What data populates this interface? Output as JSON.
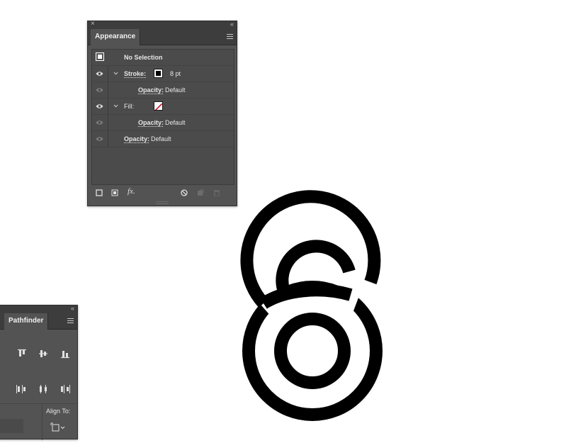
{
  "appearance": {
    "tab": "Appearance",
    "header": "No Selection",
    "rows": [
      {
        "label": "Stroke:",
        "value": "8 pt"
      },
      {
        "label": "Opacity:",
        "value": "Default"
      },
      {
        "label": "Fill:"
      },
      {
        "label": "Opacity:",
        "value": "Default"
      },
      {
        "label": "Opacity:",
        "value": "Default"
      }
    ],
    "fx": "fx."
  },
  "pathfinder": {
    "tab": "Pathfinder",
    "align_to_label": "Align To:"
  },
  "colors": {
    "panel": "#535353",
    "artwork": "#000000",
    "fill_none_slash": "#c8102e"
  },
  "icons": [
    "close-icon",
    "collapse-icon",
    "menu-icon",
    "eye-icon",
    "chevron-down-icon",
    "add-stroke-icon",
    "add-fill-icon",
    "fx-icon",
    "clear-icon",
    "duplicate-icon",
    "trash-icon",
    "align-icon"
  ]
}
